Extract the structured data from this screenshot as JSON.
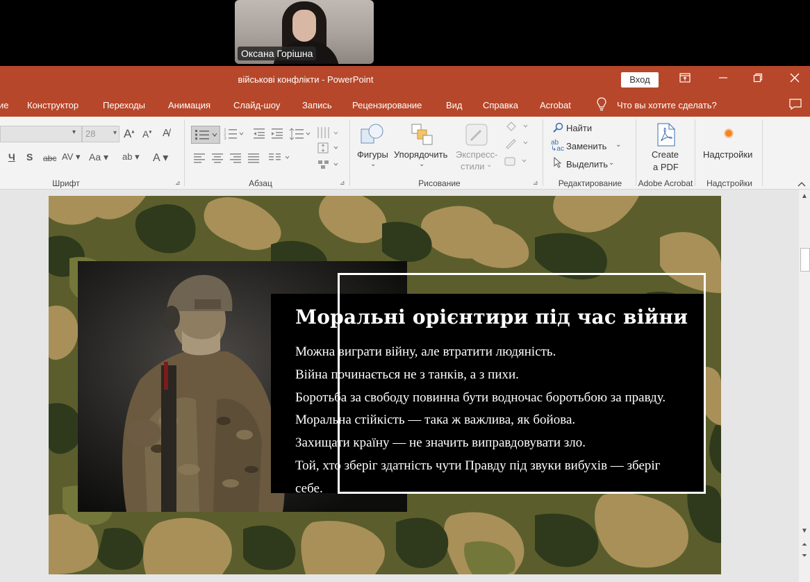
{
  "call": {
    "participant_name": "Оксана Горішна"
  },
  "titlebar": {
    "title": "військові конфлікти  -  PowerPoint",
    "signin_label": "Вход",
    "icons": [
      "ribbon-display-options-icon",
      "minimize-icon",
      "restore-icon",
      "close-icon"
    ]
  },
  "menu": {
    "tabs": [
      "ие",
      "Конструктор",
      "Переходы",
      "Анимация",
      "Слайд-шоу",
      "Запись",
      "Рецензирование",
      "Вид",
      "Справка",
      "Acrobat"
    ],
    "tell_me": "Что вы хотите сделать?"
  },
  "ribbon": {
    "font": {
      "size_value": "28",
      "group_label": "Шрифт"
    },
    "paragraph": {
      "group_label": "Абзац"
    },
    "drawing": {
      "shapes_label": "Фигуры",
      "arrange_label": "Упорядочить",
      "quick_styles_label_1": "Экспресс-",
      "quick_styles_label_2": "стили",
      "group_label": "Рисование"
    },
    "editing": {
      "find_label": "Найти",
      "replace_label": "Заменить",
      "select_label": "Выделить",
      "group_label": "Редактирование"
    },
    "acrobat": {
      "create_pdf_1": "Create",
      "create_pdf_2": "a PDF",
      "group_label": "Adobe Acrobat"
    },
    "addins": {
      "label": "Надстройки",
      "group_label": "Надстройки"
    }
  },
  "slide": {
    "title": "Моральні орієнтири під час війни",
    "lines": [
      "Можна виграти війну, але втратити людяність.",
      "Війна починається не з танків, а з пихи.",
      "Боротьба за свободу повинна бути водночас боротьбою за правду.",
      "Моральна стійкість — така ж важлива, як бойова.",
      "Захищати країну — не значить виправдовувати зло.",
      "Той, хто зберіг здатність чути Правду під звуки вибухів — зберіг",
      "себе."
    ]
  },
  "colors": {
    "accent": "#b7472a",
    "camo_base": "#5b5e2c",
    "camo_light": "#a89058",
    "camo_dark": "#2f3a1c"
  }
}
